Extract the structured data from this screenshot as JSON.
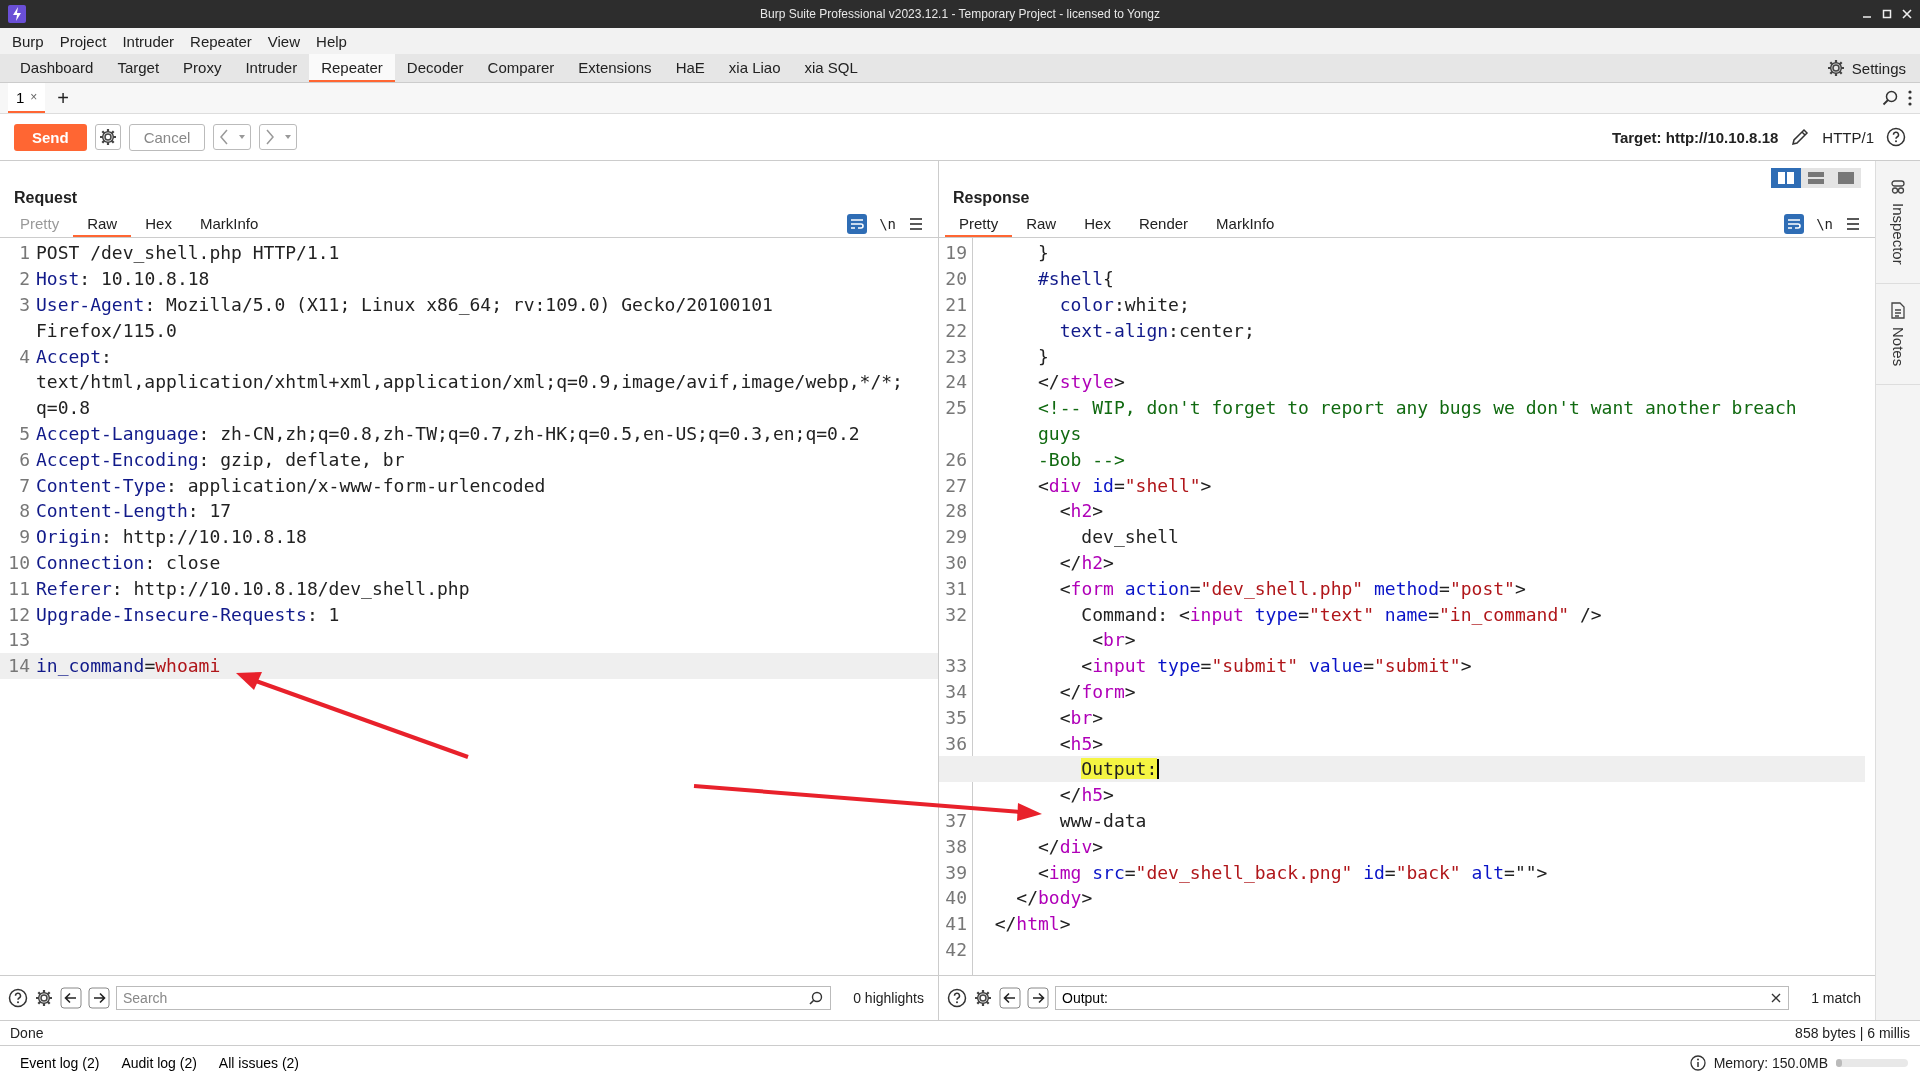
{
  "window": {
    "title": "Burp Suite Professional v2023.12.1 - Temporary Project - licensed to Yongz"
  },
  "menu": [
    "Burp",
    "Project",
    "Intruder",
    "Repeater",
    "View",
    "Help"
  ],
  "main_tabs": [
    {
      "label": "Dashboard",
      "selected": false
    },
    {
      "label": "Target",
      "selected": false
    },
    {
      "label": "Proxy",
      "selected": false
    },
    {
      "label": "Intruder",
      "selected": false
    },
    {
      "label": "Repeater",
      "selected": true
    },
    {
      "label": "Decoder",
      "selected": false
    },
    {
      "label": "Comparer",
      "selected": false
    },
    {
      "label": "Extensions",
      "selected": false
    },
    {
      "label": "HaE",
      "selected": false
    },
    {
      "label": "xia Liao",
      "selected": false
    },
    {
      "label": "xia SQL",
      "selected": false
    }
  ],
  "settings": "Settings",
  "repeater_tabs": [
    {
      "label": "1",
      "close": "×",
      "selected": true
    }
  ],
  "add_tab": "+",
  "toolbar": {
    "send": "Send",
    "cancel": "Cancel",
    "target": "Target: http://10.10.8.18",
    "protocol": "HTTP/1"
  },
  "layout_buttons": [
    {
      "kind": "side",
      "selected": true
    },
    {
      "kind": "stacked",
      "selected": false
    },
    {
      "kind": "single",
      "selected": false
    }
  ],
  "request": {
    "title": "Request",
    "tabs": [
      {
        "label": "Pretty",
        "selected": false,
        "disabled": true
      },
      {
        "label": "Raw",
        "selected": true,
        "disabled": false
      },
      {
        "label": "Hex",
        "selected": false,
        "disabled": false
      },
      {
        "label": "MarkInfo",
        "selected": false,
        "disabled": false
      }
    ],
    "newline_toggle": "\\n",
    "rows": [
      {
        "num": "1",
        "tokens": [
          {
            "kind": "plain",
            "text": "POST /dev_shell.php HTTP/1.1"
          }
        ]
      },
      {
        "num": "2",
        "tokens": [
          {
            "kind": "key",
            "text": "Host"
          },
          {
            "kind": "plain",
            "text": ": 10.10.8.18"
          }
        ]
      },
      {
        "num": "3",
        "tokens": [
          {
            "kind": "key",
            "text": "User-Agent"
          },
          {
            "kind": "plain",
            "text": ": Mozilla/5.0 (X11; Linux x86_64; rv:109.0) Gecko/20100101"
          }
        ]
      },
      {
        "tokens": [
          {
            "kind": "plain",
            "text": "Firefox/115.0"
          }
        ]
      },
      {
        "num": "4",
        "tokens": [
          {
            "kind": "key",
            "text": "Accept"
          },
          {
            "kind": "plain",
            "text": ":"
          }
        ]
      },
      {
        "tokens": [
          {
            "kind": "plain",
            "text": "text/html,application/xhtml+xml,application/xml;q=0.9,image/avif,image/webp,*/*;"
          }
        ]
      },
      {
        "tokens": [
          {
            "kind": "plain",
            "text": "q=0.8"
          }
        ]
      },
      {
        "num": "5",
        "tokens": [
          {
            "kind": "key",
            "text": "Accept-Language"
          },
          {
            "kind": "plain",
            "text": ": zh-CN,zh;q=0.8,zh-TW;q=0.7,zh-HK;q=0.5,en-US;q=0.3,en;q=0.2"
          }
        ]
      },
      {
        "num": "6",
        "tokens": [
          {
            "kind": "key",
            "text": "Accept-Encoding"
          },
          {
            "kind": "plain",
            "text": ": gzip, deflate, br"
          }
        ]
      },
      {
        "num": "7",
        "tokens": [
          {
            "kind": "key",
            "text": "Content-Type"
          },
          {
            "kind": "plain",
            "text": ": application/x-www-form-urlencoded"
          }
        ]
      },
      {
        "num": "8",
        "tokens": [
          {
            "kind": "key",
            "text": "Content-Length"
          },
          {
            "kind": "plain",
            "text": ": 17"
          }
        ]
      },
      {
        "num": "9",
        "tokens": [
          {
            "kind": "key",
            "text": "Origin"
          },
          {
            "kind": "plain",
            "text": ": http://10.10.8.18"
          }
        ]
      },
      {
        "num": "10",
        "tokens": [
          {
            "kind": "key",
            "text": "Connection"
          },
          {
            "kind": "plain",
            "text": ": close"
          }
        ]
      },
      {
        "num": "11",
        "tokens": [
          {
            "kind": "key",
            "text": "Referer"
          },
          {
            "kind": "plain",
            "text": ": http://10.10.8.18/dev_shell.php"
          }
        ]
      },
      {
        "num": "12",
        "tokens": [
          {
            "kind": "key",
            "text": "Upgrade-Insecure-Requests"
          },
          {
            "kind": "plain",
            "text": ": 1"
          }
        ]
      },
      {
        "num": "13"
      },
      {
        "num": "14",
        "current": true,
        "tokens": [
          {
            "kind": "key",
            "text": "in_command"
          },
          {
            "kind": "plain",
            "text": "="
          },
          {
            "kind": "str",
            "text": "whoami"
          }
        ]
      }
    ],
    "search": {
      "placeholder": "Search"
    },
    "search_result": "0 highlights"
  },
  "response": {
    "title": "Response",
    "tabs": [
      {
        "label": "Pretty",
        "selected": true,
        "disabled": false
      },
      {
        "label": "Raw",
        "selected": false,
        "disabled": false
      },
      {
        "label": "Hex",
        "selected": false,
        "disabled": false
      },
      {
        "label": "Render",
        "selected": false,
        "disabled": false
      },
      {
        "label": "MarkInfo",
        "selected": false,
        "disabled": false
      }
    ],
    "newline_toggle": "\\n",
    "rows": [
      {
        "num": "19",
        "tokens": [
          {
            "kind": "plain",
            "text": "      }"
          }
        ]
      },
      {
        "num": "20",
        "tokens": [
          {
            "kind": "key",
            "text": "      #shell"
          },
          {
            "kind": "plain",
            "text": "{"
          }
        ]
      },
      {
        "num": "21",
        "tokens": [
          {
            "kind": "key",
            "text": "        color"
          },
          {
            "kind": "plain",
            "text": ":white;"
          }
        ]
      },
      {
        "num": "22",
        "tokens": [
          {
            "kind": "key",
            "text": "        text-align"
          },
          {
            "kind": "plain",
            "text": ":center;"
          }
        ]
      },
      {
        "num": "23",
        "tokens": [
          {
            "kind": "plain",
            "text": "      }"
          }
        ]
      },
      {
        "num": "24",
        "tokens": [
          {
            "kind": "plain",
            "text": "      </"
          },
          {
            "kind": "tag",
            "text": "style"
          },
          {
            "kind": "plain",
            "text": ">"
          }
        ]
      },
      {
        "num": "25",
        "tokens": [
          {
            "kind": "comment",
            "text": "      <!-- WIP, don't forget to report any bugs we don't want another breach"
          }
        ]
      },
      {
        "tokens": [
          {
            "kind": "comment",
            "text": "      guys"
          }
        ]
      },
      {
        "num": "26",
        "tokens": [
          {
            "kind": "comment",
            "text": "      -Bob -->"
          }
        ]
      },
      {
        "num": "27",
        "tokens": [
          {
            "kind": "plain",
            "text": "      <"
          },
          {
            "kind": "tag",
            "text": "div"
          },
          {
            "kind": "attr",
            "text": " id"
          },
          {
            "kind": "plain",
            "text": "="
          },
          {
            "kind": "str",
            "text": "\"shell\""
          },
          {
            "kind": "plain",
            "text": ">"
          }
        ]
      },
      {
        "num": "28",
        "tokens": [
          {
            "kind": "plain",
            "text": "        <"
          },
          {
            "kind": "tag",
            "text": "h2"
          },
          {
            "kind": "plain",
            "text": ">"
          }
        ]
      },
      {
        "num": "29",
        "tokens": [
          {
            "kind": "plain",
            "text": "          dev_shell"
          }
        ]
      },
      {
        "num": "30",
        "tokens": [
          {
            "kind": "plain",
            "text": "        </"
          },
          {
            "kind": "tag",
            "text": "h2"
          },
          {
            "kind": "plain",
            "text": ">"
          }
        ]
      },
      {
        "num": "31",
        "tokens": [
          {
            "kind": "plain",
            "text": "        <"
          },
          {
            "kind": "tag",
            "text": "form"
          },
          {
            "kind": "attr",
            "text": " action"
          },
          {
            "kind": "plain",
            "text": "="
          },
          {
            "kind": "str",
            "text": "\"dev_shell.php\""
          },
          {
            "kind": "attr",
            "text": " method"
          },
          {
            "kind": "plain",
            "text": "="
          },
          {
            "kind": "str",
            "text": "\"post\""
          },
          {
            "kind": "plain",
            "text": ">"
          }
        ]
      },
      {
        "num": "32",
        "tokens": [
          {
            "kind": "plain",
            "text": "          Command: <"
          },
          {
            "kind": "tag",
            "text": "input"
          },
          {
            "kind": "attr",
            "text": " type"
          },
          {
            "kind": "plain",
            "text": "="
          },
          {
            "kind": "str",
            "text": "\"text\""
          },
          {
            "kind": "attr",
            "text": " name"
          },
          {
            "kind": "plain",
            "text": "="
          },
          {
            "kind": "str",
            "text": "\"in_command\""
          },
          {
            "kind": "plain",
            "text": " />"
          }
        ]
      },
      {
        "tokens": [
          {
            "kind": "plain",
            "text": "           <"
          },
          {
            "kind": "tag",
            "text": "br"
          },
          {
            "kind": "plain",
            "text": ">"
          }
        ]
      },
      {
        "num": "33",
        "tokens": [
          {
            "kind": "plain",
            "text": "          <"
          },
          {
            "kind": "tag",
            "text": "input"
          },
          {
            "kind": "attr",
            "text": " type"
          },
          {
            "kind": "plain",
            "text": "="
          },
          {
            "kind": "str",
            "text": "\"submit\""
          },
          {
            "kind": "attr",
            "text": " value"
          },
          {
            "kind": "plain",
            "text": "="
          },
          {
            "kind": "str",
            "text": "\"submit\""
          },
          {
            "kind": "plain",
            "text": ">"
          }
        ]
      },
      {
        "num": "34",
        "tokens": [
          {
            "kind": "plain",
            "text": "        </"
          },
          {
            "kind": "tag",
            "text": "form"
          },
          {
            "kind": "plain",
            "text": ">"
          }
        ]
      },
      {
        "num": "35",
        "tokens": [
          {
            "kind": "plain",
            "text": "        <"
          },
          {
            "kind": "tag",
            "text": "br"
          },
          {
            "kind": "plain",
            "text": ">"
          }
        ]
      },
      {
        "num": "36",
        "tokens": [
          {
            "kind": "plain",
            "text": "        <"
          },
          {
            "kind": "tag",
            "text": "h5"
          },
          {
            "kind": "plain",
            "text": ">"
          }
        ]
      },
      {
        "current": true,
        "caret": true,
        "tokens": [
          {
            "kind": "match",
            "text": "Output:"
          }
        ]
      },
      {
        "tokens": [
          {
            "kind": "plain",
            "text": "        </"
          },
          {
            "kind": "tag",
            "text": "h5"
          },
          {
            "kind": "plain",
            "text": ">"
          }
        ]
      },
      {
        "num": "37",
        "tokens": [
          {
            "kind": "plain",
            "text": "        www-data"
          }
        ]
      },
      {
        "num": "38",
        "tokens": [
          {
            "kind": "plain",
            "text": "      </"
          },
          {
            "kind": "tag",
            "text": "div"
          },
          {
            "kind": "plain",
            "text": ">"
          }
        ]
      },
      {
        "num": "39",
        "tokens": [
          {
            "kind": "plain",
            "text": "      <"
          },
          {
            "kind": "tag",
            "text": "img"
          },
          {
            "kind": "attr",
            "text": " src"
          },
          {
            "kind": "plain",
            "text": "="
          },
          {
            "kind": "str",
            "text": "\"dev_shell_back.png\""
          },
          {
            "kind": "attr",
            "text": " id"
          },
          {
            "kind": "plain",
            "text": "="
          },
          {
            "kind": "str",
            "text": "\"back\""
          },
          {
            "kind": "attr",
            "text": " alt"
          },
          {
            "kind": "plain",
            "text": "=\"\">"
          }
        ]
      },
      {
        "num": "40",
        "tokens": [
          {
            "kind": "plain",
            "text": "    </"
          },
          {
            "kind": "tag",
            "text": "body"
          },
          {
            "kind": "plain",
            "text": ">"
          }
        ]
      },
      {
        "num": "41",
        "tokens": [
          {
            "kind": "plain",
            "text": "  </"
          },
          {
            "kind": "tag",
            "text": "html"
          },
          {
            "kind": "plain",
            "text": ">"
          }
        ]
      },
      {
        "num": "42"
      }
    ],
    "search": {
      "value": "Output:"
    },
    "search_result": "1 match"
  },
  "side_panels": [
    "Inspector",
    "Notes"
  ],
  "status": {
    "left": "Done",
    "right": "858 bytes | 6 millis"
  },
  "bottom_bar": {
    "tabs": [
      "Event log (2)",
      "Audit log (2)",
      "All issues (2)"
    ],
    "memory": "Memory: 150.0MB",
    "memory_meter": {
      "level": 0.08
    }
  }
}
